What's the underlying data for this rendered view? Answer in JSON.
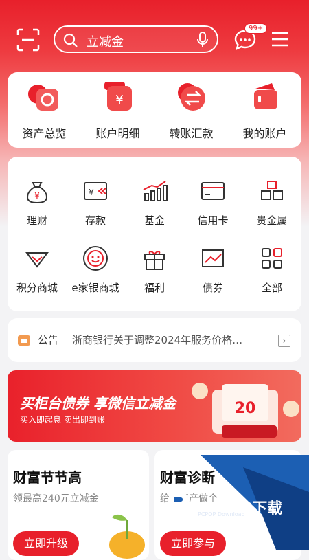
{
  "search": {
    "text": "立减金"
  },
  "messages": {
    "badge": "99+"
  },
  "quick_actions": [
    {
      "label": "资产总览",
      "icon": "asset-overview-icon"
    },
    {
      "label": "账户明细",
      "icon": "account-detail-icon"
    },
    {
      "label": "转账汇款",
      "icon": "transfer-icon"
    },
    {
      "label": "我的账户",
      "icon": "my-account-icon"
    }
  ],
  "services": [
    {
      "label": "理财",
      "icon": "money-bag-icon"
    },
    {
      "label": "存款",
      "icon": "deposit-icon"
    },
    {
      "label": "基金",
      "icon": "fund-chart-icon"
    },
    {
      "label": "信用卡",
      "icon": "credit-card-icon"
    },
    {
      "label": "贵金属",
      "icon": "gold-bars-icon"
    },
    {
      "label": "积分商城",
      "icon": "diamond-icon"
    },
    {
      "label": "e家银商城",
      "icon": "mall-face-icon"
    },
    {
      "label": "福利",
      "icon": "gift-icon"
    },
    {
      "label": "债券",
      "icon": "bond-chart-icon"
    },
    {
      "label": "全部",
      "icon": "grid-icon"
    }
  ],
  "notice": {
    "tag": "公告",
    "content": "浙商银行关于调整2024年服务价格…"
  },
  "banner": {
    "title": "买柜台债券 享微信立减金",
    "subtitle": "买入即起息  卖出即到账",
    "amount": "20"
  },
  "wealth": [
    {
      "title": "财富节节高",
      "subtitle": "领最高240元立减金",
      "button": "立即升级"
    },
    {
      "title": "财富诊断",
      "subtitle": "给您资产做个",
      "button": "立即参与"
    }
  ],
  "watermark": {
    "text": "PCPOP下载",
    "sub": "PCPOP Download"
  },
  "colors": {
    "brand": "#e8202b",
    "watermark": "#1c5fb3"
  }
}
